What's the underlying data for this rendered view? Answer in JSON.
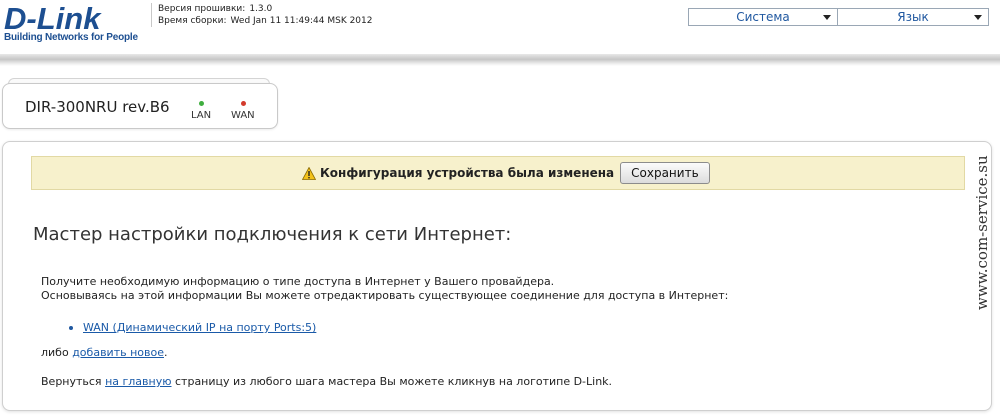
{
  "header": {
    "logo_text": "D-Link",
    "logo_tagline": "Building Networks for People",
    "firmware_label": "Версия прошивки:",
    "firmware_value": "1.3.0",
    "build_label": "Время сборки:",
    "build_value": "Wed Jan 11 11:49:44 MSK 2012",
    "menu": [
      {
        "label": "Система",
        "icon": "chevron-down-icon"
      },
      {
        "label": "Язык",
        "icon": "chevron-down-icon"
      }
    ]
  },
  "device": {
    "model": "DIR-300NRU rev.B6",
    "leds": [
      {
        "label": "LAN",
        "color": "#3fae3f"
      },
      {
        "label": "WAN",
        "color": "#d33a2c"
      }
    ]
  },
  "notice": {
    "icon": "warning-icon",
    "text": "Конфигурация устройства была изменена",
    "save_label": "Сохранить",
    "background": "#f7f1cc"
  },
  "wizard": {
    "title": "Мастер настройки подключения к сети Интернет:",
    "line1": "Получите необходимую информацию о типе доступа в Интернет у Вашего провайдера.",
    "line2": "Основываясь на этой информации Вы можете отредактировать существующее соединение для доступа в Интернет:",
    "connections": [
      {
        "label": "WAN (Динамический IP на порту Ports:5)"
      }
    ],
    "or_prefix": "либо",
    "add_link": "добавить новое",
    "or_suffix": ".",
    "back_prefix": "Вернуться",
    "home_link": "на главную",
    "back_suffix": "страницу из любого шага мастера Вы можете кликнув на логотипе D-Link."
  },
  "watermark": "www.com-service.su",
  "colors": {
    "accent": "#1d4f91",
    "link": "#1a5aa8"
  }
}
